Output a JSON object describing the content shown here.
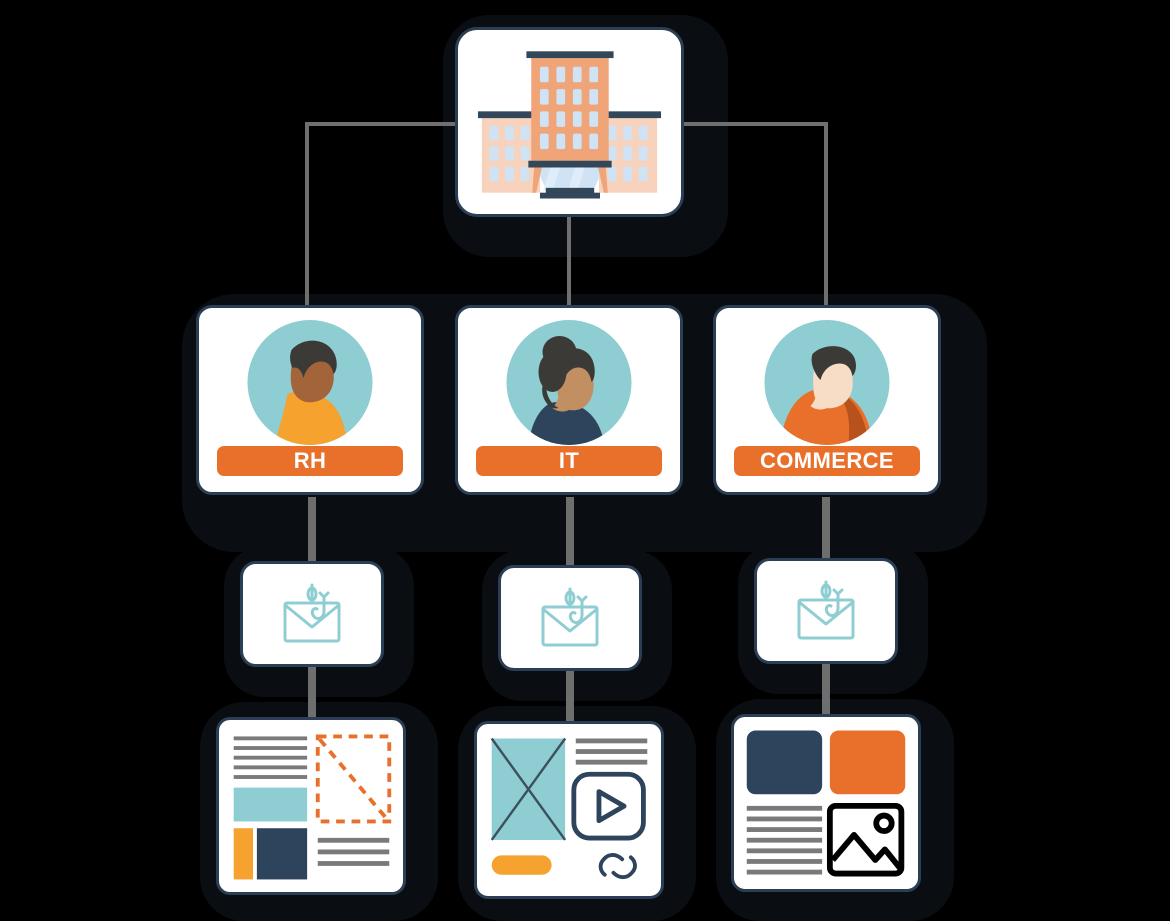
{
  "diagram": {
    "title": "Phishing simulation campaign org chart",
    "type": "organizational-tree",
    "levels": 4
  },
  "colors": {
    "background": "#000000",
    "card_background": "#ffffff",
    "card_border": "#2a3f55",
    "accent_orange": "#e8702a",
    "accent_orange_light": "#f59b36",
    "accent_teal": "#8ecdd2",
    "accent_navy": "#2e435c",
    "connector_gray": "#706f6f",
    "text_gray": "#7a7a7a"
  },
  "root": {
    "node_id": "company",
    "icon": "office-building-icon",
    "label": ""
  },
  "departments": [
    {
      "node_id": "rh",
      "label": "RH",
      "avatar": "person-avatar-orange-shirt",
      "label_color": "#e8702a"
    },
    {
      "node_id": "it",
      "label": "IT",
      "avatar": "person-avatar-navy-shirt",
      "label_color": "#e8702a"
    },
    {
      "node_id": "commerce",
      "label": "COMMERCE",
      "avatar": "person-avatar-orange-jacket",
      "label_color": "#e8702a"
    }
  ],
  "phishing_emails": [
    {
      "node_id": "mail-rh",
      "icon": "phishing-email-hook-icon",
      "label": ""
    },
    {
      "node_id": "mail-it",
      "icon": "phishing-email-hook-icon",
      "label": ""
    },
    {
      "node_id": "mail-commerce",
      "icon": "phishing-email-hook-icon",
      "label": ""
    }
  ],
  "landing_pages": [
    {
      "node_id": "page-rh",
      "icon": "landing-page-text-image-icon",
      "label": ""
    },
    {
      "node_id": "page-it",
      "icon": "landing-page-video-link-icon",
      "label": ""
    },
    {
      "node_id": "page-commerce",
      "icon": "landing-page-blocks-photo-icon",
      "label": ""
    }
  ],
  "connectors": {
    "root_to_departments": "solid",
    "departments_to_emails": "dashed",
    "emails_to_pages": "dashed"
  }
}
